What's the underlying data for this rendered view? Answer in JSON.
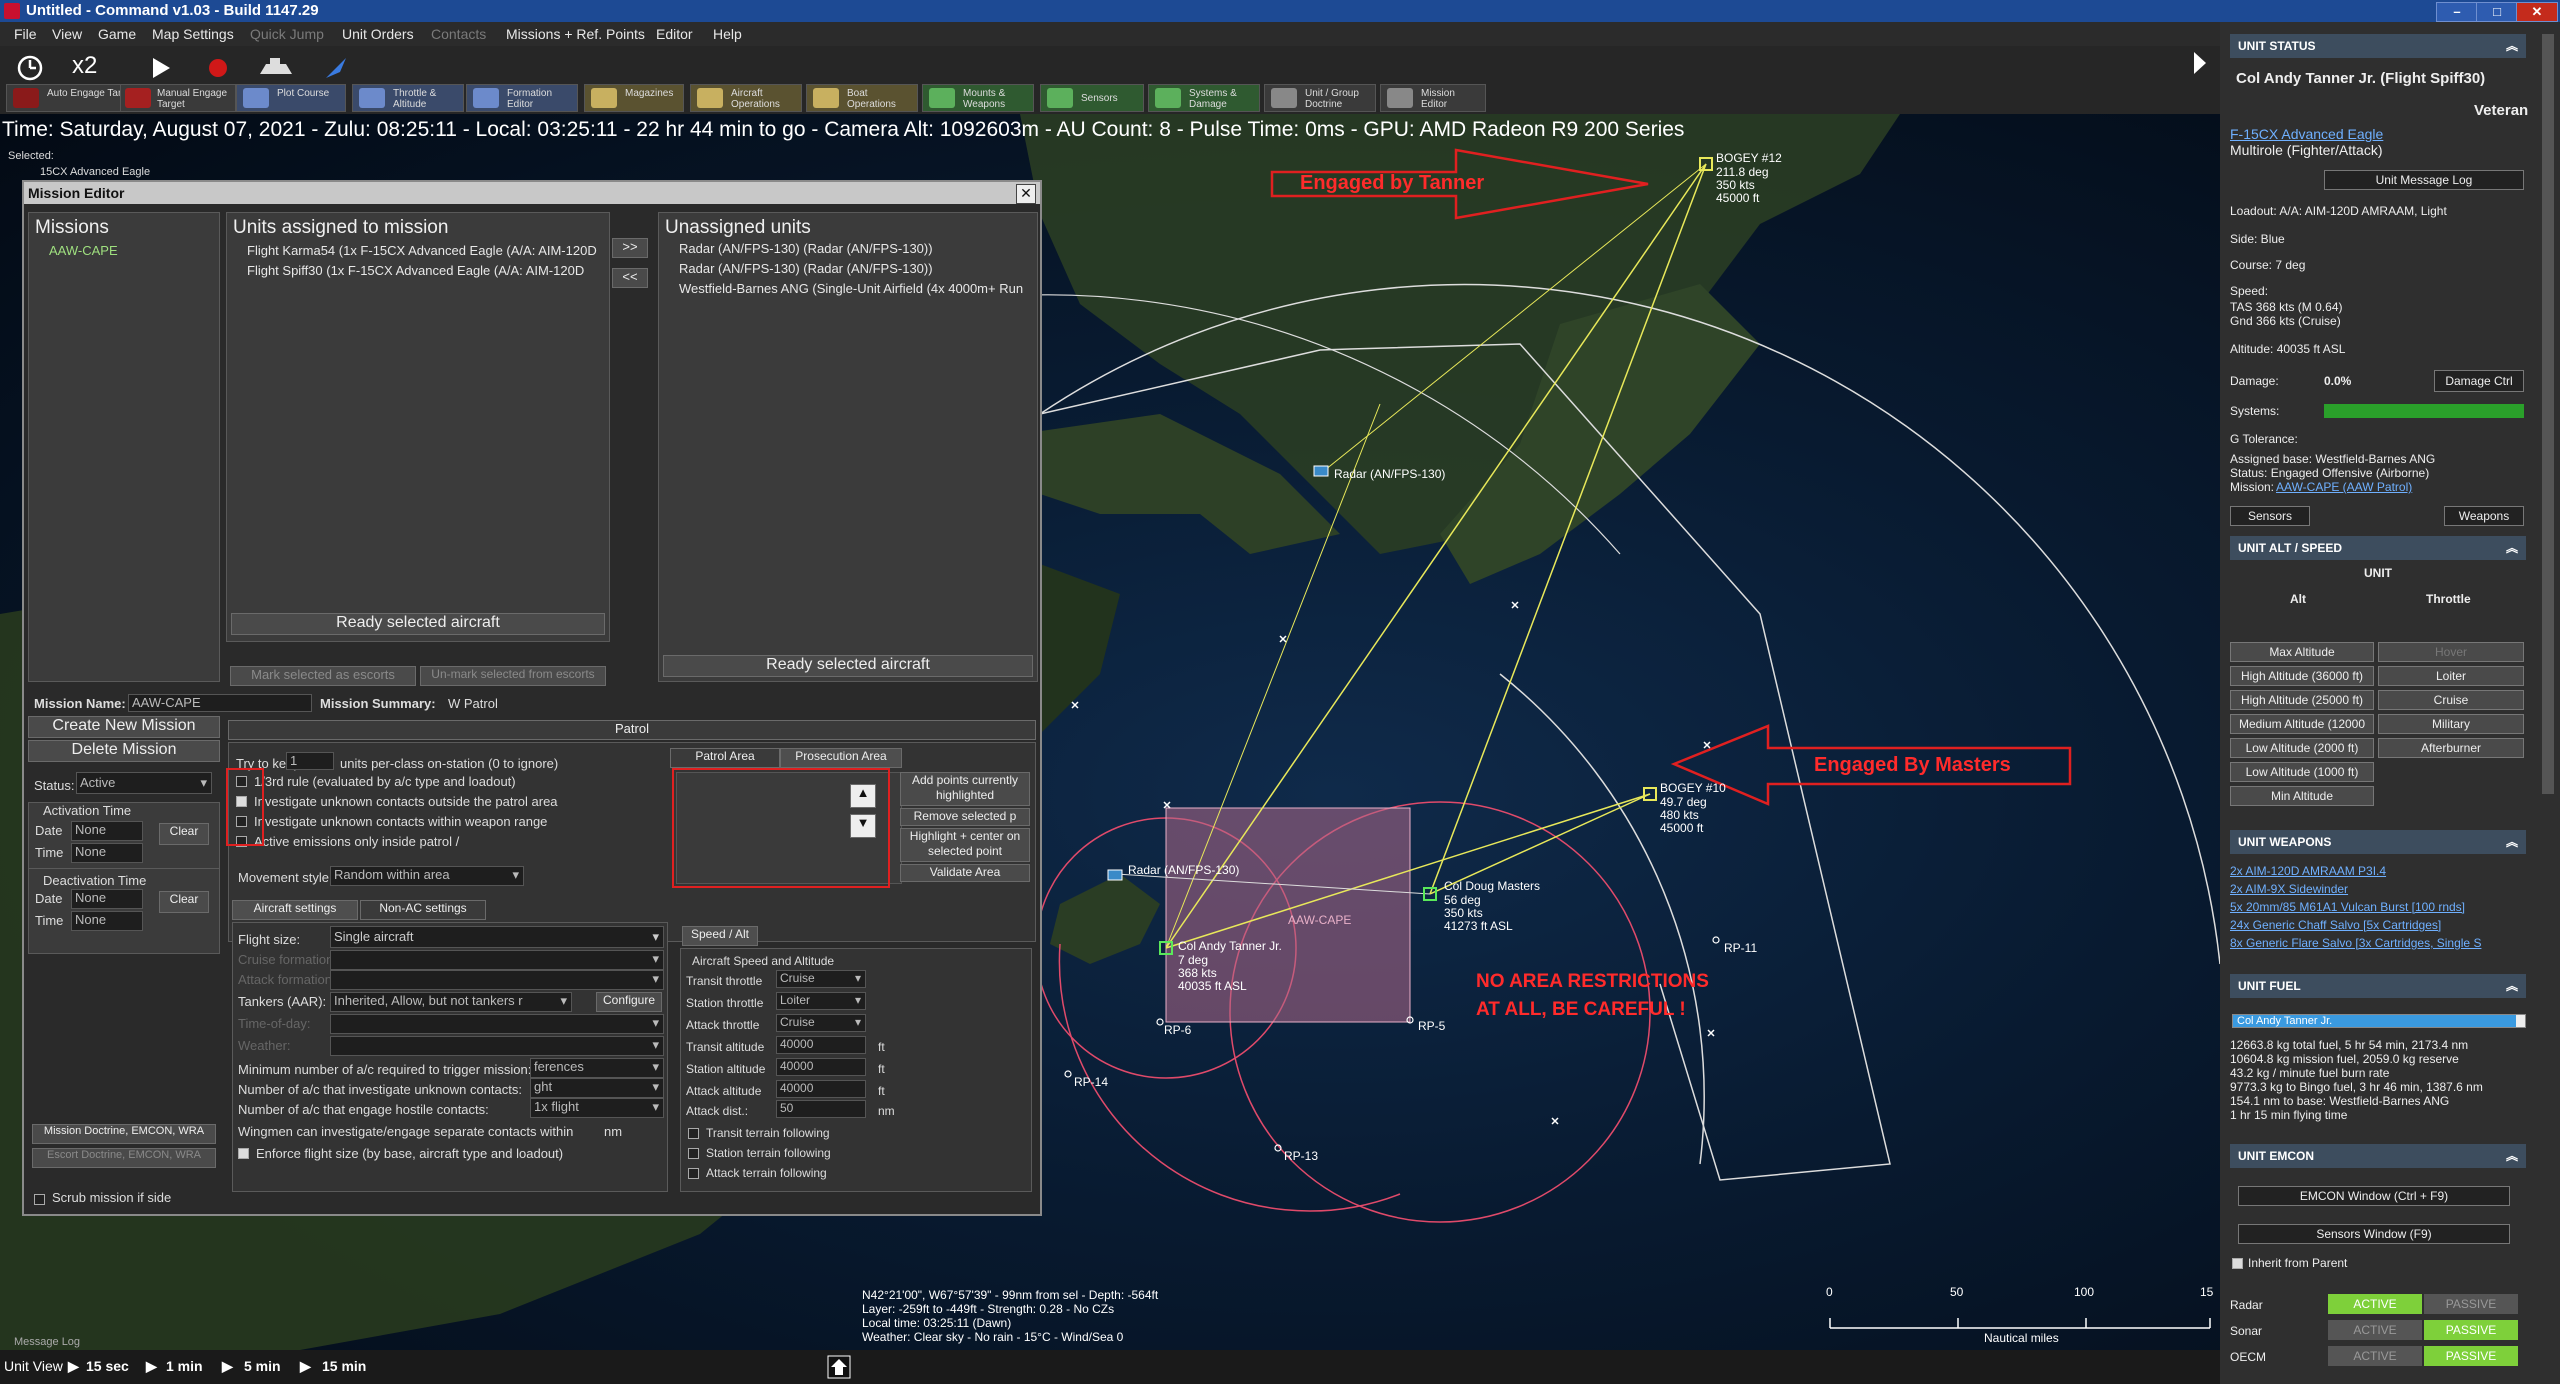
{
  "window": {
    "title": "Untitled - Command v1.03 - Build 1147.29",
    "minimize": "–",
    "maximize": "□",
    "close": "✕"
  },
  "menu": [
    "File",
    "View",
    "Game",
    "Map Settings",
    "Quick Jump",
    "Unit Orders",
    "Contacts",
    "Missions + Ref. Points",
    "Editor",
    "Help"
  ],
  "toolbar": {
    "time_compression": "x2",
    "buttons": [
      {
        "label": "Auto Engage Target",
        "icon": "auto-engage-icon"
      },
      {
        "label": "Manual Engage Target",
        "icon": "manual-engage-icon"
      },
      {
        "label": "Plot Course",
        "icon": "plot-course-icon"
      },
      {
        "label": "Throttle & Altitude",
        "icon": "throttle-icon"
      },
      {
        "label": "Formation Editor",
        "icon": "formation-icon"
      },
      {
        "label": "Magazines",
        "icon": "magazines-icon"
      },
      {
        "label": "Aircraft Operations",
        "icon": "aircraft-icon"
      },
      {
        "label": "Boat Operations",
        "icon": "boat-icon"
      },
      {
        "label": "Mounts & Weapons",
        "icon": "weapons-icon"
      },
      {
        "label": "Sensors",
        "icon": "sensors-icon"
      },
      {
        "label": "Systems & Damage",
        "icon": "systems-icon"
      },
      {
        "label": "Unit / Group Doctrine",
        "icon": "doctrine-icon"
      },
      {
        "label": "Mission Editor",
        "icon": "mission-editor-icon"
      }
    ]
  },
  "status_line": "Time: Saturday, August 07, 2021 - Zulu: 08:25:11 - Local: 03:25:11 - 22 hr 44 min to go -  Camera Alt: 1092603m  - AU Count: 8 - Pulse Time: 0ms - GPU: AMD Radeon R9 200 Series",
  "selected": {
    "label": "Selected:",
    "unit": "15CX Advanced Eagle"
  },
  "mission_editor": {
    "title": "Mission Editor",
    "missions_header": "Missions",
    "missions": [
      "AAW-CAPE"
    ],
    "assigned_header": "Units assigned to mission",
    "assigned": [
      "Flight Karma54 (1x F-15CX Advanced Eagle (A/A: AIM-120D",
      "Flight Spiff30 (1x F-15CX Advanced Eagle (A/A: AIM-120D"
    ],
    "unassigned_header": "Unassigned units",
    "unassigned": [
      "Radar (AN/FPS-130) (Radar (AN/FPS-130))",
      "Radar (AN/FPS-130) (Radar (AN/FPS-130))",
      "Westfield-Barnes ANG (Single-Unit Airfield (4x 4000m+ Run"
    ],
    "move_right": ">>",
    "move_left": "<<",
    "ready_selected_left": "Ready selected aircraft",
    "mark_escorts": "Mark selected as escorts",
    "unmark_escorts": "Un-mark selected from escorts",
    "ready_selected_right": "Ready selected aircraft",
    "mission_name_label": "Mission Name:",
    "mission_name_value": "AAW-CAPE",
    "mission_summary_label": "Mission Summary:",
    "mission_summary_value": "W Patrol",
    "create_new": "Create New Mission",
    "delete": "Delete Mission",
    "status_label": "Status:",
    "status_value": "Active",
    "activation_time": "Activation Time",
    "deactivation_time": "Deactivation Time",
    "date_label": "Date",
    "time_label": "Time",
    "none": "None",
    "clear": "Clear",
    "doctrine_btn": "Mission Doctrine, EMCON, WRA",
    "escort_btn": "Escort Doctrine, EMCON, WRA",
    "scrub": "Scrub mission if side",
    "patrol_tab": "Patrol",
    "try_to_keep": "Try to keep",
    "try_to_keep_value": "1",
    "try_to_keep_suffix": "units per-class on-station (0 to ignore)",
    "rule_third": "1/3rd rule (evaluated by a/c type and loadout)",
    "investigate_outside": "Investigate unknown contacts outside the patrol area",
    "investigate_weapon": "Investigate unknown contacts within weapon range",
    "active_emissions": "Active emissions only inside patrol /",
    "movement_style_label": "Movement style:",
    "movement_style_value": "Random within area",
    "patrol_area_tab": "Patrol Area",
    "prosecution_area_tab": "Prosecution Area",
    "add_points": "Add points currently highlighted",
    "remove_points": "Remove selected p",
    "highlight_center": "Highlight + center on selected point",
    "validate_area": "Validate Area",
    "aircraft_settings_tab": "Aircraft settings",
    "non_ac_tab": "Non-AC settings",
    "flight_size_label": "Flight size:",
    "flight_size_value": "Single aircraft",
    "cruise_formation": "Cruise formation",
    "attack_formation": "Attack formation",
    "tankers_label": "Tankers (AAR):",
    "tankers_value": "Inherited, Allow, but not tankers r",
    "configure": "Configure",
    "time_on_day": "Time-of-day:",
    "weather": "Weather:",
    "min_ac_trigger": "Minimum number of a/c required to trigger mission:",
    "min_ac_value": "ferences",
    "num_investigate": "Number of a/c that investigate unknown contacts:",
    "num_investigate_value": "ght",
    "num_engage": "Number of a/c that engage hostile contacts:",
    "num_engage_value": "1x flight",
    "wingmen": "Wingmen can investigate/engage separate contacts within",
    "wingmen_unit": "nm",
    "enforce_flight": "Enforce flight size (by base, aircraft type and loadout)",
    "speed_alt_tab": "Speed / Alt",
    "speed_alt_group": "Aircraft Speed and Altitude",
    "transit_throttle": "Transit throttle",
    "transit_throttle_value": "Cruise",
    "station_throttle": "Station throttle",
    "station_throttle_value": "Loiter",
    "attack_throttle": "Attack throttle",
    "attack_throttle_value": "Cruise",
    "transit_altitude": "Transit altitude",
    "transit_altitude_value": "40000",
    "station_altitude": "Station altitude",
    "station_altitude_value": "40000",
    "attack_altitude": "Attack altitude",
    "attack_altitude_value": "40000",
    "attack_dist": "Attack dist.:",
    "attack_dist_value": "50",
    "ft": "ft",
    "nm": "nm",
    "transit_terrain": "Transit terrain following",
    "station_terrain": "Station terrain following",
    "attack_terrain": "Attack terrain following"
  },
  "map": {
    "annotations": {
      "tanner": "Engaged by Tanner",
      "masters": "Engaged By Masters",
      "warning": "NO AREA RESTRICTIONS AT ALL, BE CAREFUL !"
    },
    "labels": {
      "bogey12": "BOGEY #12",
      "bogey12_detail": "211.8 deg\n350 kts\n45000 ft",
      "bogey10": "BOGEY #10",
      "bogey10_detail": "49.7 deg\n480 kts\n45000 ft",
      "radar_north": "Radar (AN/FPS-130)",
      "radar_south": "Radar (AN/FPS-130)",
      "masters": "Col Doug Masters",
      "masters_detail": "56 deg\n350 kts\n41273 ft ASL",
      "tanner": "Col Andy Tanner Jr.",
      "tanner_detail": "7 deg\n368 kts\n40035 ft ASL",
      "area": "AAW-CAPE",
      "rp5": "RP-5",
      "rp6": "RP-6",
      "rp11": "RP-11",
      "rp13": "RP-13",
      "rp14": "RP-14"
    },
    "cursor_info": "N42°21'00\", W67°57'39\" - 99nm from sel - Depth: -564ft\nLayer: -259ft to -449ft - Strength: 0.28 - No CZs\nLocal time: 03:25:11 (Dawn)\nWeather: Clear sky - No rain - 15°C - Wind/Sea 0",
    "scale": {
      "ticks": [
        "0",
        "50",
        "100",
        "15"
      ],
      "unit": "Nautical miles"
    }
  },
  "bottom": {
    "message_log": "Message Log",
    "unit_view": "Unit View",
    "ticks": [
      "15 sec",
      "1 min",
      "5 min",
      "15 min"
    ]
  },
  "unit_status": {
    "header": "UNIT STATUS",
    "name": "Col Andy Tanner Jr. (Flight Spiff30)",
    "rank": "Veteran",
    "type": "F-15CX Advanced Eagle",
    "role": "Multirole (Fighter/Attack)",
    "message_log_btn": "Unit Message Log",
    "loadout": "Loadout: A/A: AIM-120D AMRAAM, Light",
    "side": "Side: Blue",
    "course": "Course: 7 deg",
    "speed": "Speed:",
    "tas": "TAS 368 kts (M 0.64)",
    "gnd": "Gnd 366 kts (Cruise)",
    "altitude": "Altitude: 40035 ft ASL",
    "damage": "Damage:",
    "damage_value": "0.0%",
    "damage_ctrl": "Damage Ctrl",
    "systems": "Systems:",
    "g_tolerance": "G Tolerance:",
    "assigned_base": "Assigned base: Westfield-Barnes ANG",
    "status": "Status: Engaged Offensive (Airborne)",
    "mission_label": "Mission:",
    "mission_value": "AAW-CAPE (AAW Patrol)",
    "sensors_btn": "Sensors",
    "weapons_btn": "Weapons"
  },
  "alt_speed": {
    "header": "UNIT ALT / SPEED",
    "unit": "UNIT",
    "alt": "Alt",
    "throttle": "Throttle",
    "alt_buttons": [
      "Max Altitude",
      "High Altitude (36000 ft)",
      "High Altitude (25000 ft)",
      "Medium Altitude (12000",
      "Low Altitude (2000 ft)",
      "Low Altitude (1000 ft)",
      "Min Altitude"
    ],
    "throttle_buttons": [
      "Hover",
      "Loiter",
      "Cruise",
      "Military",
      "Afterburner"
    ]
  },
  "weapons": {
    "header": "UNIT WEAPONS",
    "items": [
      "2x AIM-120D AMRAAM P3I.4",
      "2x AIM-9X Sidewinder",
      "5x 20mm/85 M61A1 Vulcan Burst [100 rnds]",
      "24x Generic Chaff Salvo [5x Cartridges]",
      "8x Generic Flare Salvo [3x Cartridges, Single S"
    ]
  },
  "fuel": {
    "header": "UNIT FUEL",
    "bar_label": "Col Andy Tanner Jr.",
    "level": 0.97,
    "lines": [
      "12663.8 kg total fuel, 5 hr 54 min, 2173.4 nm",
      "10604.8 kg mission fuel, 2059.0 kg reserve",
      "43.2 kg / minute fuel burn rate",
      "9773.3 kg to Bingo fuel, 3 hr 46 min, 1387.6 nm",
      "154.1 nm to base: Westfield-Barnes ANG",
      "1 hr 15 min flying time"
    ]
  },
  "emcon": {
    "header": "UNIT EMCON",
    "emcon_window": "EMCON Window (Ctrl + F9)",
    "sensors_window": "Sensors Window (F9)",
    "inherit": "Inherit from Parent",
    "rows": [
      {
        "name": "Radar",
        "active": "ACTIVE",
        "passive": "PASSIVE"
      },
      {
        "name": "Sonar",
        "active": "ACTIVE",
        "passive": "PASSIVE"
      },
      {
        "name": "OECM",
        "active": "ACTIVE",
        "passive": "PASSIVE"
      }
    ]
  }
}
